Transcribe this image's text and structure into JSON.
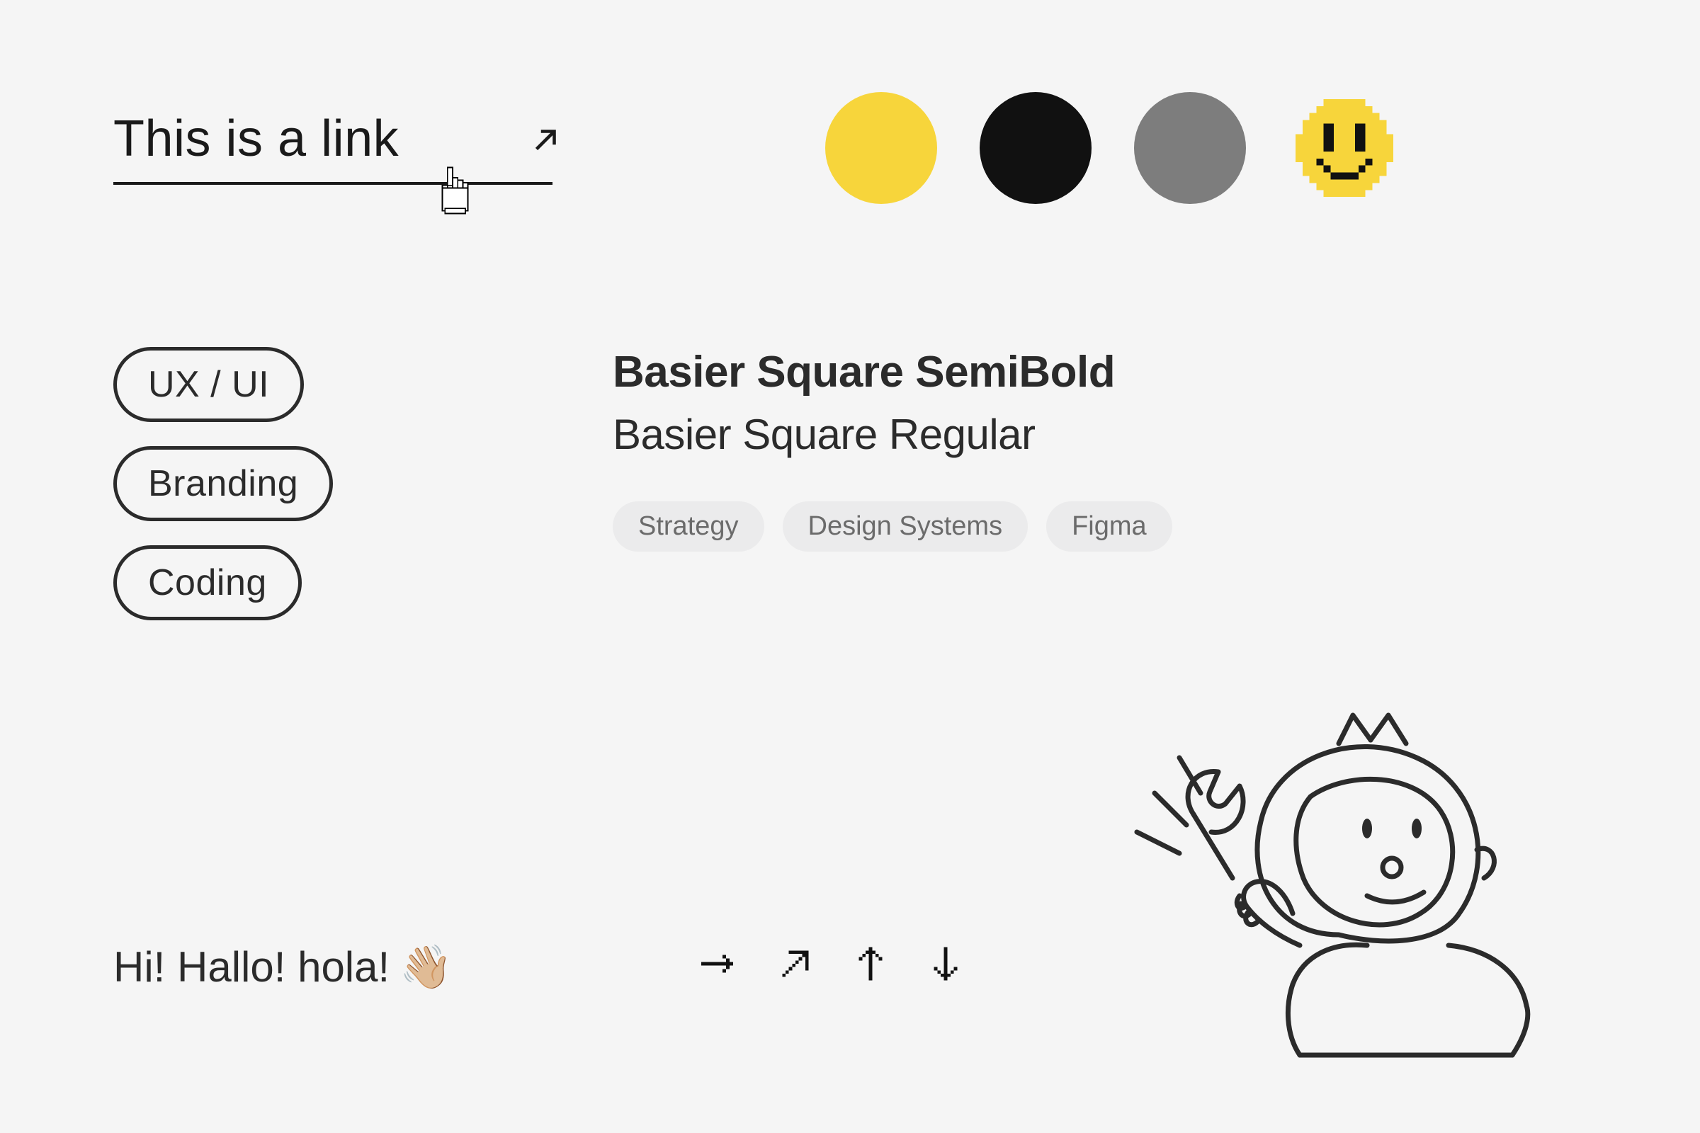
{
  "link": {
    "text": "This is a link"
  },
  "palette": {
    "yellow": "#f7d53b",
    "black": "#111111",
    "gray": "#7d7d7d"
  },
  "pills": [
    "UX / UI",
    "Branding",
    "Coding"
  ],
  "typography": {
    "semibold": "Basier Square SemiBold",
    "regular": "Basier Square Regular"
  },
  "tags": [
    "Strategy",
    "Design Systems",
    "Figma"
  ],
  "greeting": {
    "text": "Hi! Hallo! hola!",
    "emoji": "👋🏼"
  },
  "arrows": [
    "right",
    "up-right",
    "up",
    "down"
  ]
}
